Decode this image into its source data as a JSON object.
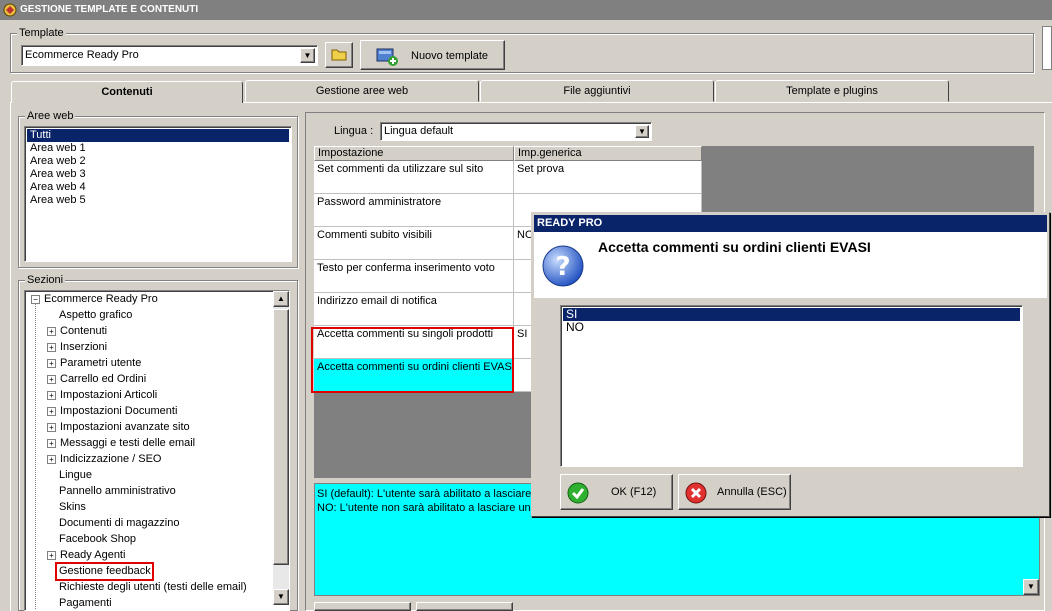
{
  "window": {
    "title": "GESTIONE TEMPLATE E CONTENUTI"
  },
  "template_group": {
    "label": "Template",
    "selected": "Ecommerce Ready Pro",
    "new_button": "Nuovo template"
  },
  "tabs": [
    {
      "label": "Contenuti",
      "active": true
    },
    {
      "label": "Gestione aree web"
    },
    {
      "label": "File aggiuntivi"
    },
    {
      "label": "Template e plugins"
    }
  ],
  "aree_web": {
    "label": "Aree web",
    "items": [
      "Tutti",
      "Area web 1",
      "Area web 2",
      "Area web 3",
      "Area web 4",
      "Area web 5"
    ]
  },
  "sezioni": {
    "label": "Sezioni",
    "root": "Ecommerce Ready Pro",
    "items": [
      {
        "label": "Aspetto grafico",
        "expandable": false
      },
      {
        "label": "Contenuti",
        "expandable": true
      },
      {
        "label": "Inserzioni",
        "expandable": true
      },
      {
        "label": "Parametri utente",
        "expandable": true
      },
      {
        "label": "Carrello ed Ordini",
        "expandable": true
      },
      {
        "label": "Impostazioni Articoli",
        "expandable": true
      },
      {
        "label": "Impostazioni Documenti",
        "expandable": true
      },
      {
        "label": "Impostazioni avanzate sito",
        "expandable": true
      },
      {
        "label": "Messaggi e testi delle email",
        "expandable": true
      },
      {
        "label": "Indicizzazione / SEO",
        "expandable": true
      },
      {
        "label": "Lingue",
        "expandable": false
      },
      {
        "label": "Pannello amministrativo",
        "expandable": false
      },
      {
        "label": "Skins",
        "expandable": false
      },
      {
        "label": "Documenti di magazzino",
        "expandable": false
      },
      {
        "label": "Facebook Shop",
        "expandable": false
      },
      {
        "label": "Ready Agenti",
        "expandable": true
      },
      {
        "label": "Gestione feedback",
        "expandable": false,
        "highlight": true
      },
      {
        "label": "Richieste degli utenti (testi delle email)",
        "expandable": false
      },
      {
        "label": "Pagamenti",
        "expandable": false
      }
    ]
  },
  "lingua": {
    "label": "Lingua :",
    "selected": "Lingua default"
  },
  "grid": {
    "headers": [
      "Impostazione",
      "Imp.generica"
    ],
    "rows": [
      {
        "name": "Set commenti da utilizzare sul sito",
        "value": "Set prova"
      },
      {
        "name": "Password amministratore",
        "value": ""
      },
      {
        "name": "Commenti subito visibili",
        "value": "NO"
      },
      {
        "name": "Testo per conferma inserimento voto",
        "value": ""
      },
      {
        "name": "Indirizzo email di notifica",
        "value": ""
      },
      {
        "name": "Accetta commenti su singoli prodotti",
        "value": "SI"
      },
      {
        "name": "Accetta commenti su ordini clienti EVASI",
        "value": ""
      }
    ]
  },
  "description": {
    "line1": "SI (default): L'utente sarà abilitato a lasciare u",
    "line2": "NO: L'utente non sarà abilitato a lasciare un f"
  },
  "dialog": {
    "title": "READY PRO",
    "question": "Accetta commenti su ordini clienti EVASI",
    "options": [
      "SI",
      "NO"
    ],
    "selected_option": "SI",
    "ok_button": "OK (F12)",
    "cancel_button": "Annulla (ESC)"
  },
  "colors": {
    "cyan": "#00ffff",
    "selection": "#0a246a",
    "highlight_border": "#e00000"
  }
}
